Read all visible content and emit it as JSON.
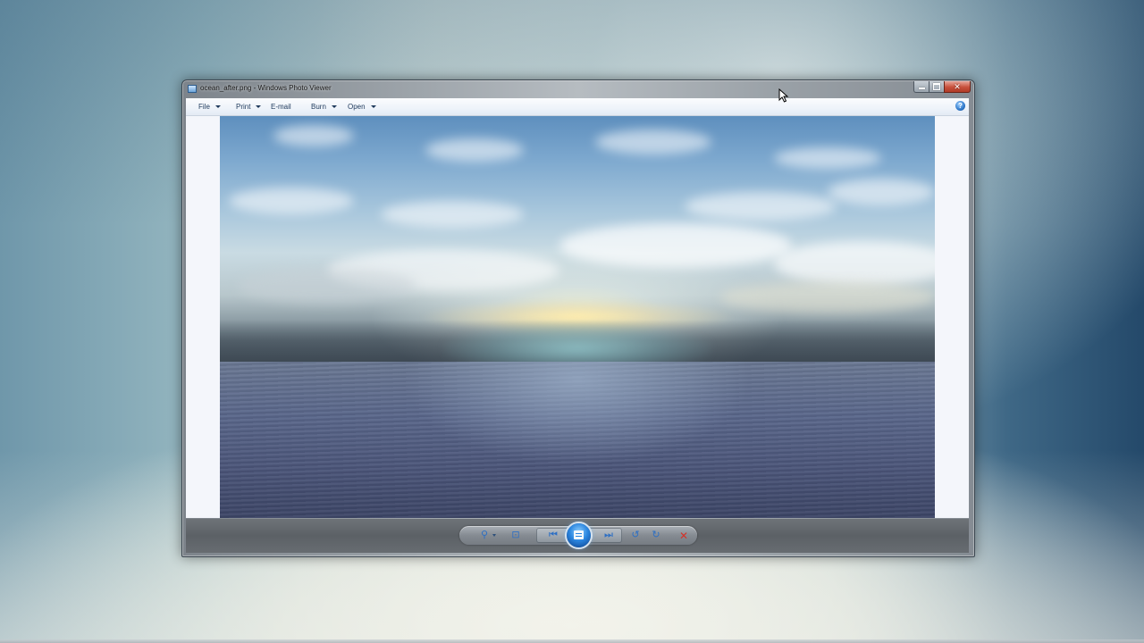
{
  "window": {
    "title": "ocean_after.png - Windows Photo Viewer"
  },
  "menu": {
    "items": [
      {
        "label": "File",
        "has_dropdown": true
      },
      {
        "label": "Print",
        "has_dropdown": true
      },
      {
        "label": "E-mail",
        "has_dropdown": false
      },
      {
        "label": "Burn",
        "has_dropdown": true
      },
      {
        "label": "Open",
        "has_dropdown": true
      }
    ],
    "help_glyph": "?"
  },
  "controls": {
    "zoom_icon": "magnifier-icon",
    "fit_icon": "actual-size-icon",
    "prev_icon": "previous-icon",
    "slideshow_icon": "slideshow-icon",
    "next_icon": "next-icon",
    "rotate_ccw_icon": "rotate-counterclockwise-icon",
    "rotate_cw_icon": "rotate-clockwise-icon",
    "delete_icon": "delete-icon",
    "zoom_glyph": "⚲",
    "fit_glyph": "⊡",
    "prev_glyph": "⏮",
    "next_glyph": "⏭",
    "rotate_ccw_glyph": "↺",
    "rotate_cw_glyph": "↻",
    "delete_glyph": "✕"
  },
  "caption": {
    "close_glyph": "✕"
  },
  "colors": {
    "accent": "#2d6fc4",
    "delete": "#d4332a",
    "close_button": "#c7503b"
  }
}
